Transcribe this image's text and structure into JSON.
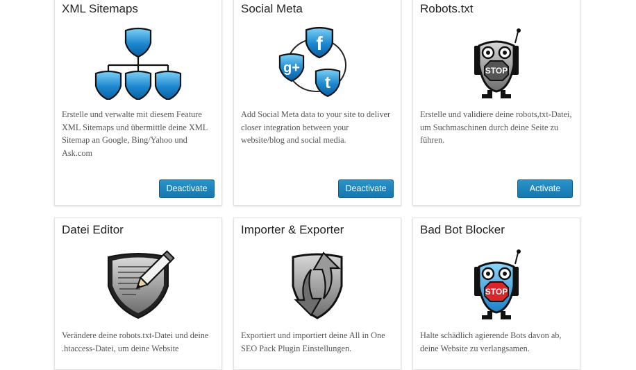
{
  "modules": [
    {
      "title": "XML Sitemaps",
      "icon": "sitemap-icon",
      "description": "Erstelle und verwalte mit diesem Feature XML Sitemaps und übermittle deine XML Sitemap an Google, Bing/Yahoo und Ask.com",
      "button": "Deactivate"
    },
    {
      "title": "Social Meta",
      "icon": "social-network-icon",
      "description": "Add Social Meta data to your site to deliver closer integration between your website/blog and social media.",
      "button": "Deactivate"
    },
    {
      "title": "Robots.txt",
      "icon": "robot-stop-icon",
      "description": "Erstelle und validiere deine robots,txt-Datei, um Suchmaschinen durch deine Seite zu führen.",
      "button": "Activate"
    },
    {
      "title": "Datei Editor",
      "icon": "file-editor-icon",
      "description": "Verändere deine robots.txt-Datei und deine .htaccess-Datei, um deine Website"
    },
    {
      "title": "Importer & Exporter",
      "icon": "import-export-icon",
      "description": "Exportiert und importiert deine All in One SEO Pack Plugin Einstellungen."
    },
    {
      "title": "Bad Bot Blocker",
      "icon": "bad-bot-icon",
      "description": "Halte schädlich agierende Bots davon ab, deine Website zu verlangsamen."
    }
  ],
  "colors": {
    "shield_blue": "#1a7fc4",
    "button_blue": "#1577ad",
    "robot_gray": "#8c8c8c",
    "stop_red": "#d8262b"
  }
}
